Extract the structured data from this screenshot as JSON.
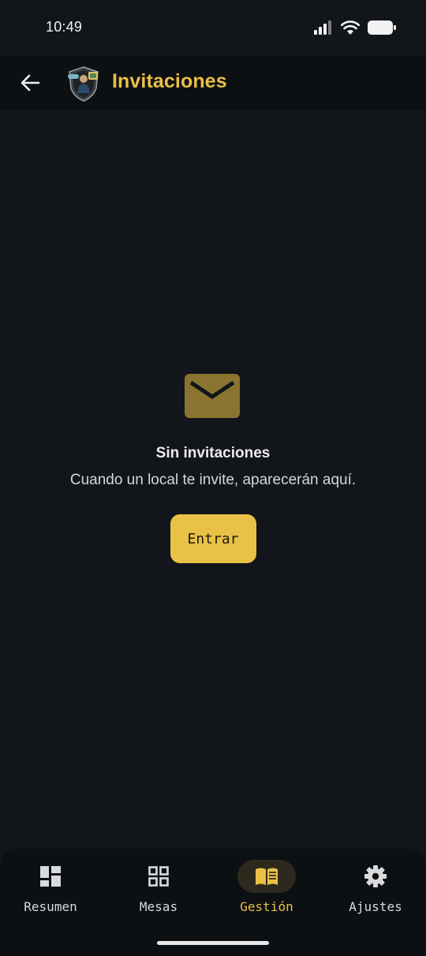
{
  "status_bar": {
    "time": "10:49"
  },
  "app_bar": {
    "title": "Invitaciones",
    "back_icon": "arrow-left-icon",
    "logo": "app-logo"
  },
  "empty_state": {
    "icon": "mail-icon",
    "title": "Sin invitaciones",
    "subtitle": "Cuando un local te invite, aparecerán aquí.",
    "button_label": "Entrar"
  },
  "bottom_nav": {
    "items": [
      {
        "label": "Resumen",
        "icon": "dashboard-icon",
        "active": false
      },
      {
        "label": "Mesas",
        "icon": "grid-icon",
        "active": false
      },
      {
        "label": "Gestión",
        "icon": "book-icon",
        "active": true
      },
      {
        "label": "Ajustes",
        "icon": "gear-icon",
        "active": false
      }
    ]
  },
  "colors": {
    "background": "#12151a",
    "bar": "#0d1013",
    "accent": "#e9c146",
    "accent_dim": "#8a7430",
    "active_pill": "#2d2a1d",
    "text": "#ededee"
  }
}
